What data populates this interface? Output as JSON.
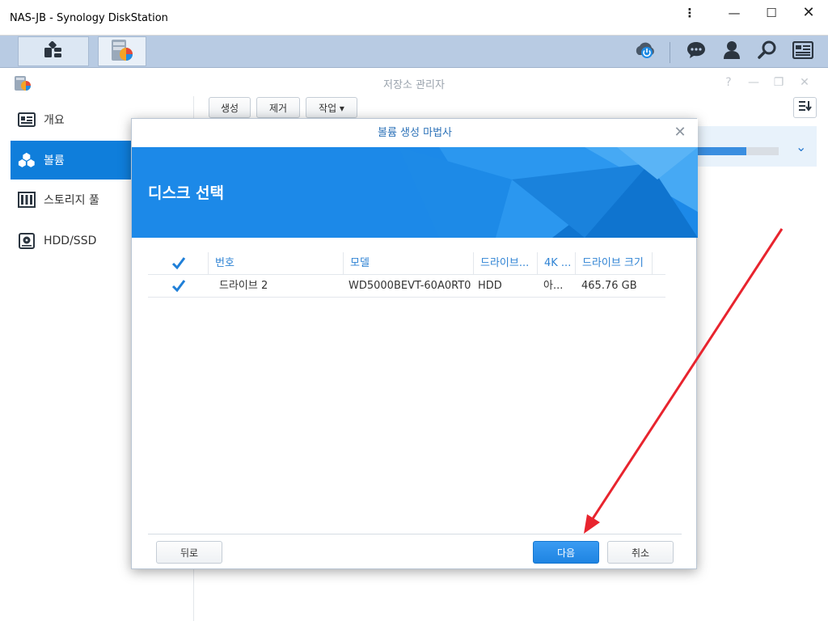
{
  "window": {
    "title": "NAS-JB - Synology DiskStation",
    "menu_glyph": "⋮",
    "min_glyph": "—",
    "max_glyph": "☐",
    "close_glyph": "✕"
  },
  "taskbar": {
    "icons": [
      "main-menu-icon",
      "storage-manager-icon",
      "cloud-power-icon",
      "chat-icon",
      "user-icon",
      "search-icon",
      "widgets-icon"
    ]
  },
  "app": {
    "title": "저장소 관리자",
    "help_glyph": "?",
    "min_glyph": "—",
    "max_glyph": "❐",
    "close_glyph": "✕"
  },
  "sidebar": {
    "items": [
      {
        "label": "개요",
        "icon": "overview-icon",
        "active": false
      },
      {
        "label": "볼륨",
        "icon": "volume-icon",
        "active": true
      },
      {
        "label": "스토리지 풀",
        "icon": "storage-pool-icon",
        "active": false
      },
      {
        "label": "HDD/SSD",
        "icon": "hdd-icon",
        "active": false
      }
    ]
  },
  "toolbar": {
    "create_label": "생성",
    "remove_label": "제거",
    "action_label": "작업 ▾"
  },
  "volume": {
    "usage_fraction": 0.6,
    "expand_glyph": "⌄"
  },
  "dialog": {
    "title": "볼륨 생성 마법사",
    "close_glyph": "✕",
    "banner_title": "디스크 선택",
    "columns": [
      "번호",
      "모델",
      "드라이브...",
      "4K ...",
      "드라이브 크기"
    ],
    "rows": [
      {
        "checked": true,
        "number": "드라이브 2",
        "model": "WD5000BEVT-60A0RT0",
        "type": "HDD",
        "4k": "아...",
        "size": "465.76 GB"
      }
    ],
    "back_label": "뒤로",
    "next_label": "다음",
    "cancel_label": "취소"
  },
  "colors": {
    "accent": "#0f7edb",
    "annotation_arrow": "#e8242e"
  }
}
